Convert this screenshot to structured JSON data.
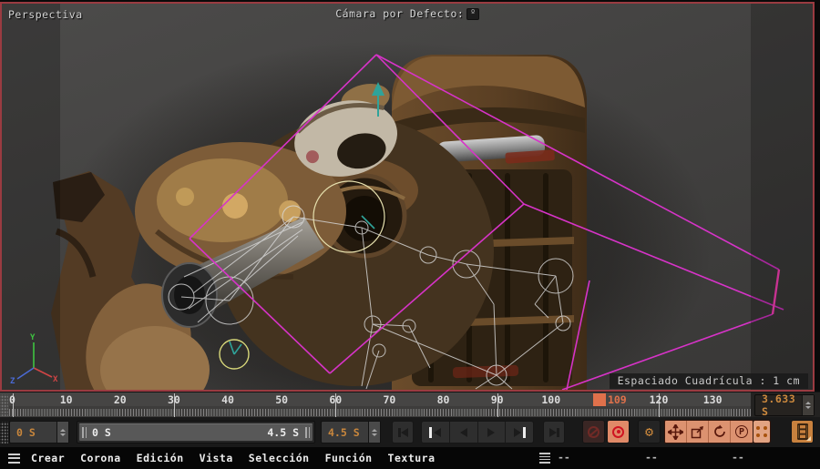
{
  "viewport": {
    "view_label": "Perspectiva",
    "camera_label": "Cámara por Defecto:",
    "camera_badge": "º",
    "grid_info": "Espaciado Cuadrícula : 1 cm",
    "axis_labels": {
      "x": "X",
      "y": "Y",
      "z": "Z"
    }
  },
  "timeline": {
    "tick_labels": [
      "0",
      "10",
      "20",
      "30",
      "40",
      "50",
      "60",
      "70",
      "80",
      "90",
      "100",
      "120",
      "130"
    ],
    "second_marks": [
      0,
      30,
      60,
      90,
      120
    ],
    "current_frame": "109",
    "current_time": "3.633 S",
    "accent_color": "#e0714b"
  },
  "transport": {
    "start_value": "0 S",
    "range_start_label": "0 S",
    "range_end_label": "4.5 S",
    "end_value": "4.5 S"
  },
  "icons": {
    "gear": "⚙",
    "parameter_letter": "P"
  },
  "menus": {
    "items": [
      "Crear",
      "Corona",
      "Edición",
      "Vista",
      "Selección",
      "Función",
      "Textura"
    ]
  },
  "statusbar": {
    "values": [
      "--",
      "--",
      "--"
    ]
  }
}
